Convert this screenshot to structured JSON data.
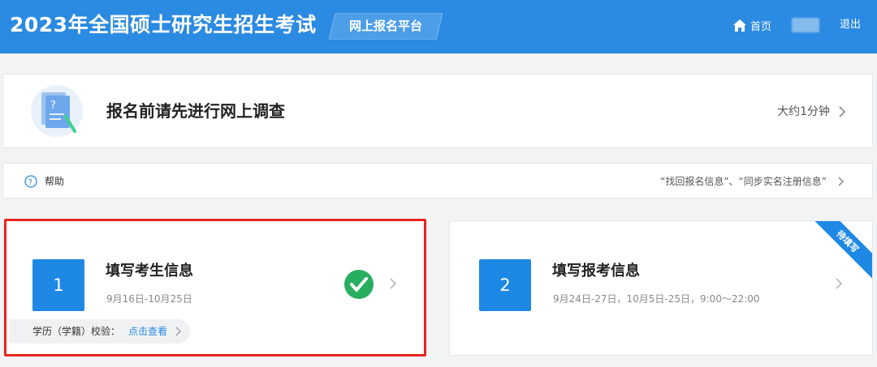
{
  "header": {
    "site_title": "2023年全国硕士研究生招生考试",
    "platform_badge": "网上报名平台",
    "home_label": "首页",
    "logout_label": "退出"
  },
  "survey": {
    "title": "报名前请先进行网上调查",
    "time": "大约1分钟"
  },
  "help": {
    "label": "帮助",
    "links": "“找回报名信息”、“同步实名注册信息”"
  },
  "steps": [
    {
      "number": "1",
      "title": "填写考生信息",
      "dates": "9月16日-10月25日",
      "status": "completed",
      "verify_label": "学历（学籍）校验：",
      "verify_link": "点击查看"
    },
    {
      "number": "2",
      "title": "填写报考信息",
      "dates": "9月24日-27日，10月5日-25日，9:00～22:00",
      "ribbon": "待填写"
    }
  ],
  "colors": {
    "header_bg": "#2b8ae2",
    "step_box": "#1e88e5",
    "check_green": "#27ae60",
    "highlight_red": "#e8251c"
  },
  "icons": {
    "home": "home-icon",
    "help": "question-circle-icon",
    "chevron": "chevron-right-icon",
    "check": "check-circle-icon"
  }
}
